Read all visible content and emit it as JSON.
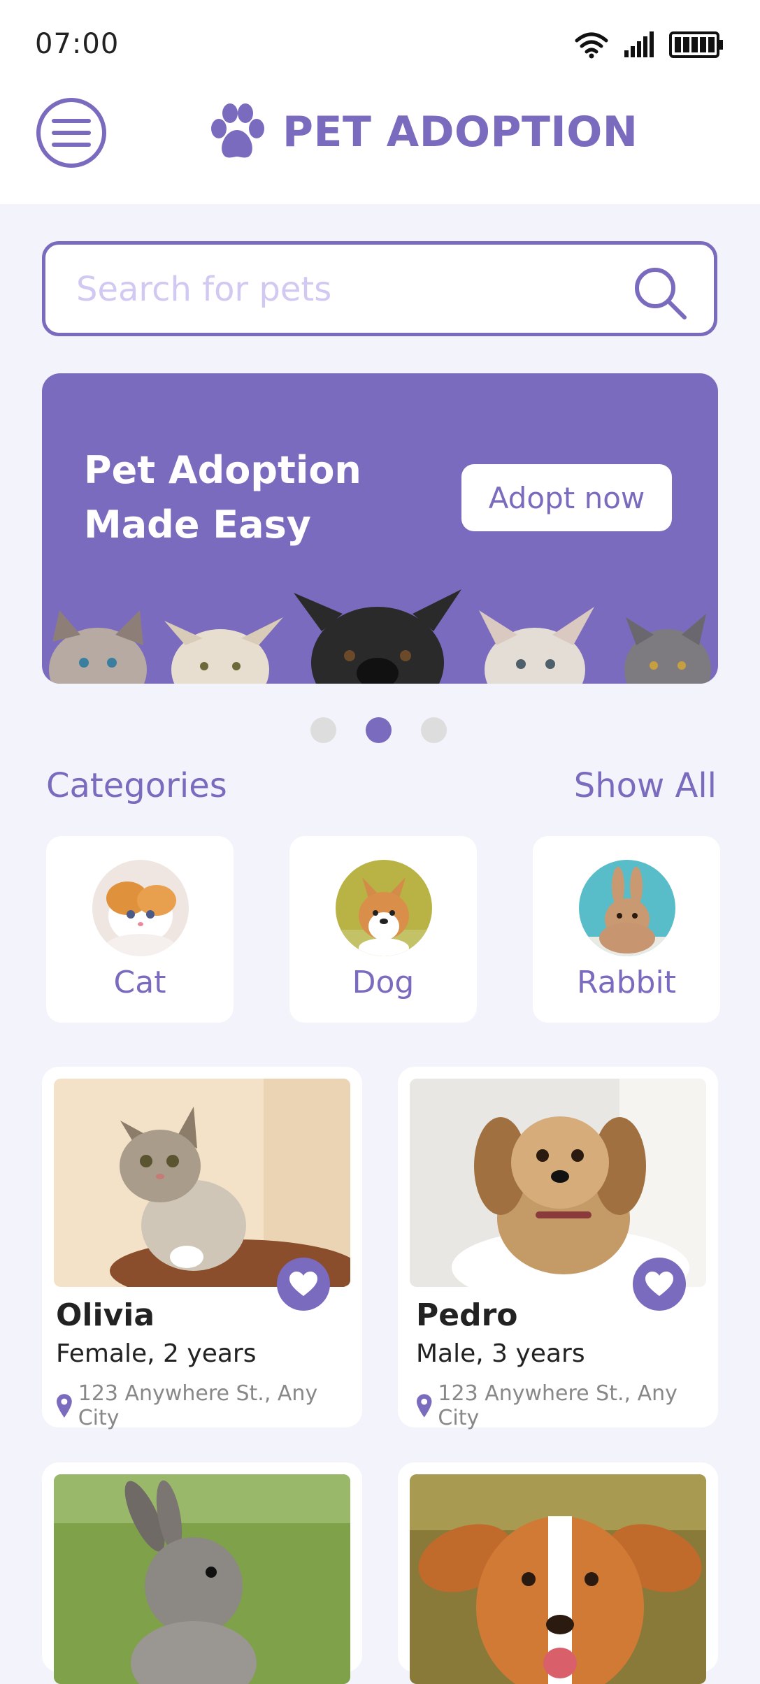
{
  "status_bar": {
    "time": "07:00"
  },
  "header": {
    "title": "PET ADOPTION"
  },
  "search": {
    "placeholder": "Search for pets"
  },
  "banner": {
    "title": "Pet Adoption\nMade Easy",
    "button": "Adopt now",
    "active_slide": 2,
    "slide_count": 3
  },
  "categories": {
    "heading": "Categories",
    "show_all": "Show All",
    "items": [
      {
        "label": "Cat"
      },
      {
        "label": "Dog"
      },
      {
        "label": "Rabbit"
      }
    ]
  },
  "pets": [
    {
      "name": "Olivia",
      "info": "Female, 2 years",
      "address": "123 Anywhere St., Any City"
    },
    {
      "name": "Pedro",
      "info": "Male, 3 years",
      "address": "123 Anywhere St., Any City"
    }
  ],
  "colors": {
    "accent": "#7b6bbf",
    "background": "#f3f3fb",
    "placeholder": "#d2c9f2"
  },
  "icons": [
    "menu-icon",
    "paw-icon",
    "search-icon",
    "heart-icon",
    "location-pin-icon",
    "wifi-icon",
    "signal-icon",
    "battery-icon"
  ]
}
